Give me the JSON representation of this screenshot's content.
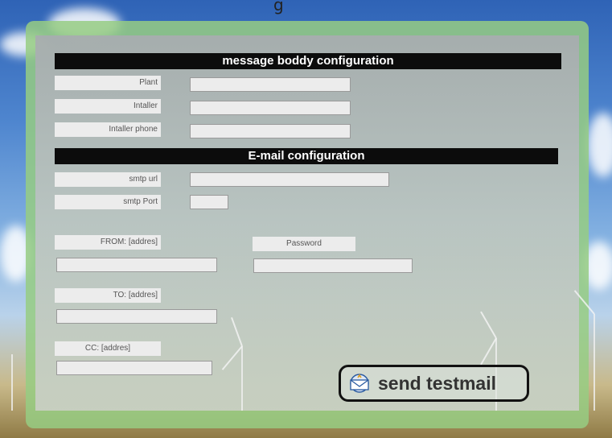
{
  "top_caption": "g",
  "sections": {
    "message": {
      "title": "message boddy configuration"
    },
    "email": {
      "title": "E-mail configuration"
    }
  },
  "labels": {
    "plant": "Plant",
    "installer": "Intaller",
    "installer_phone": "Intaller phone",
    "smtp_url": "smtp url",
    "smtp_port": "smtp Port",
    "from": "FROM: [addres]",
    "password": "Password",
    "to": "TO: [addres]",
    "cc": "CC: [addres]"
  },
  "fields": {
    "plant": "",
    "installer": "",
    "installer_phone": "",
    "smtp_url": "",
    "smtp_port": "",
    "from": "",
    "password": "",
    "to": "",
    "cc": ""
  },
  "send_button": {
    "label": "send testmail",
    "icon": "mail-send-icon"
  },
  "colors": {
    "panel_border": "#96cd82",
    "header_bar": "#0c0c0c"
  }
}
